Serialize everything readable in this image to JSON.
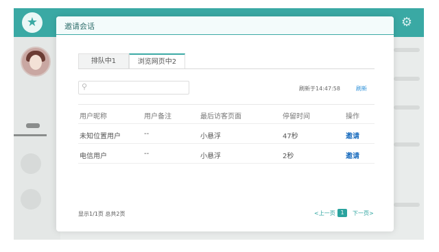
{
  "modal": {
    "title": "邀请会话",
    "tabs": [
      {
        "label": "排队中1"
      },
      {
        "label": "浏览网页中2"
      }
    ],
    "search": {
      "placeholder": "",
      "value": ""
    },
    "refresh_time": "刷新于14:47:58",
    "refresh_label": "刷新",
    "table": {
      "headers": [
        "用户昵称",
        "用户备注",
        "最后访客页面",
        "停留时间",
        "操作"
      ],
      "rows": [
        [
          "未知位置用户",
          "--",
          "小悬浮",
          "47秒",
          "邀请"
        ],
        [
          "电信用户",
          "--",
          "小悬浮",
          "2秒",
          "邀请"
        ]
      ]
    },
    "footer": {
      "summary": "显示1/1页 总共2页",
      "prev": "<上一页",
      "current_page": "1",
      "next": "下一页>"
    }
  },
  "icons": {
    "logo": "tooth-logo-icon",
    "settings": "gear-icon",
    "search": "search-icon"
  },
  "colors": {
    "accent": "#3aa9a4",
    "link": "#1f6fbf"
  }
}
